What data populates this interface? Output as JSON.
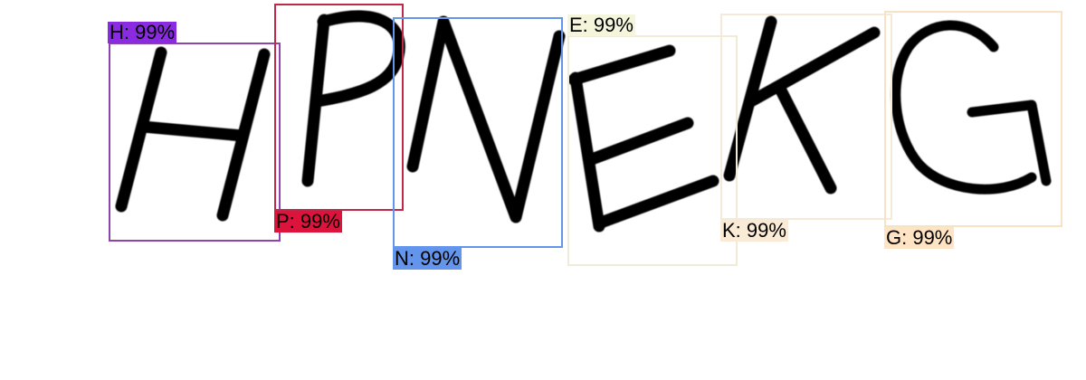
{
  "detections": [
    {
      "id": "h",
      "label": "H: 99%",
      "color": "#8e44ad",
      "label_bg": "#8a2be2"
    },
    {
      "id": "p",
      "label": "P: 99%",
      "color": "#c0284a",
      "label_bg": "#dc143c"
    },
    {
      "id": "n",
      "label": "N: 99%",
      "color": "#6495ed",
      "label_bg": "#6495ed"
    },
    {
      "id": "e",
      "label": "E: 99%",
      "color": "#f0ebd6",
      "label_bg": "#f5f5dc"
    },
    {
      "id": "k",
      "label": "K: 99%",
      "color": "#f5e9d8",
      "label_bg": "#faebd7"
    },
    {
      "id": "g",
      "label": "G: 99%",
      "color": "#f8e2c4",
      "label_bg": "#ffe4c4"
    }
  ],
  "colors": {
    "background": "#ffffff",
    "glyph": "#000000",
    "label_text": "#000000"
  }
}
